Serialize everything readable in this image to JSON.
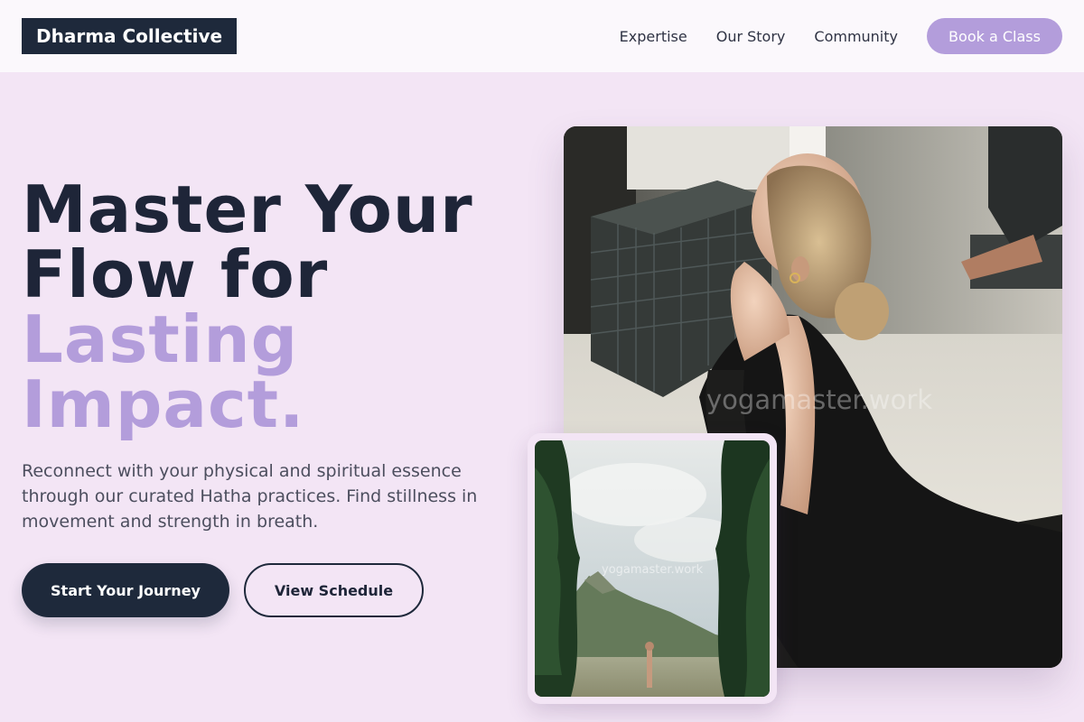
{
  "brand": {
    "name": "Dharma Collective"
  },
  "nav": {
    "links": [
      "Expertise",
      "Our Story",
      "Community"
    ],
    "cta_label": "Book a Class"
  },
  "hero": {
    "title_dark_1": "Master Your",
    "title_dark_2": "Flow for",
    "title_accent_1": "Lasting",
    "title_accent_2": "Impact.",
    "description": "Reconnect with your physical and spiritual essence through our curated Hatha practices. Find stillness in movement and strength in breath.",
    "primary_button": "Start Your Journey",
    "secondary_button": "View Schedule"
  },
  "images": {
    "main_watermark": "yogamaster.work",
    "inset_watermark": "yogamaster.work"
  },
  "colors": {
    "background": "#f3e5f5",
    "header_bg": "#fbf8fc",
    "dark": "#1e293b",
    "accent": "#b39ddb"
  }
}
